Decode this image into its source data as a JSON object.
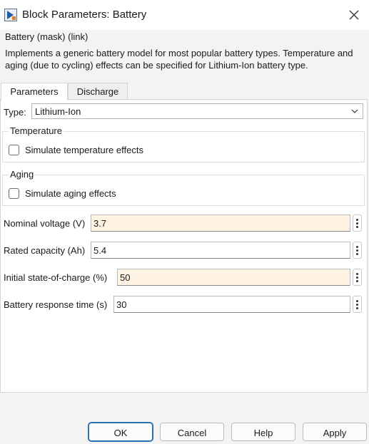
{
  "window": {
    "title": "Block Parameters: Battery"
  },
  "mask": {
    "name": "Battery (mask) (link)",
    "description": "Implements a generic battery model for most popular battery types. Temperature and aging (due to cycling) effects can be specified for Lithium-Ion battery type."
  },
  "tabs": [
    {
      "label": "Parameters",
      "active": true
    },
    {
      "label": "Discharge",
      "active": false
    }
  ],
  "type": {
    "label": "Type:",
    "value": "Lithium-Ion"
  },
  "groups": {
    "temperature": {
      "title": "Temperature",
      "checkbox_label": "Simulate temperature effects",
      "checked": false
    },
    "aging": {
      "title": "Aging",
      "checkbox_label": "Simulate aging effects",
      "checked": false
    }
  },
  "params": {
    "nominal_voltage": {
      "label": "Nominal voltage (V)",
      "value": "3.7"
    },
    "rated_capacity": {
      "label": "Rated capacity (Ah)",
      "value": "5.4"
    },
    "initial_soc": {
      "label": "Initial state-of-charge (%)",
      "value": "50"
    },
    "response_time": {
      "label": "Battery response time (s)",
      "value": "30"
    }
  },
  "buttons": {
    "ok": "OK",
    "cancel": "Cancel",
    "help": "Help",
    "apply": "Apply"
  },
  "colors": {
    "highlight_field": "#fff4e3",
    "default_button_border": "#2b6fb6"
  },
  "icons": {
    "app": "simulink-block-icon",
    "close": "close-icon",
    "dropdown": "chevron-down-icon",
    "param_menu": "vertical-ellipsis-icon"
  }
}
